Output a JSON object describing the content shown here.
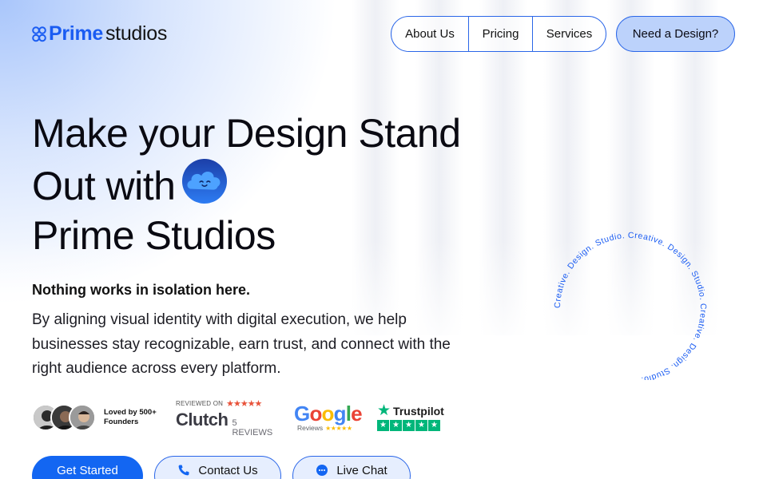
{
  "brand": {
    "name_bold": "Prime",
    "name_light": "studios",
    "accent": "#1a5cf2"
  },
  "nav": {
    "items": [
      "About Us",
      "Pricing",
      "Services"
    ],
    "cta": "Need a Design?"
  },
  "hero": {
    "title_line1": "Make your Design Stand",
    "title_line2": "Out with",
    "title_line3": "Prime Studios",
    "emoji_icon": "smiling-cloud-icon",
    "tagline": "Nothing works in isolation here.",
    "description": "By aligning visual identity with digital execution, we help businesses stay recognizable, earn trust, and connect with the right audience across every platform."
  },
  "social_proof": {
    "loved_by": "Loved by 500+ Founders",
    "clutch": {
      "reviewed_on": "REVIEWED ON",
      "name": "Clutch",
      "reviews": "5 REVIEWS",
      "stars": "★★★★★"
    },
    "google": {
      "letters": [
        "G",
        "o",
        "o",
        "g",
        "l",
        "e"
      ],
      "sub": "Reviews",
      "stars": "★★★★★"
    },
    "trustpilot": {
      "name": "Trustpilot",
      "star_glyph": "★",
      "stars": [
        "★",
        "★",
        "★",
        "★",
        "★"
      ]
    }
  },
  "buttons": {
    "get_started": "Get Started",
    "contact": "Contact Us",
    "chat": "Live Chat"
  },
  "ring_text": "Creative. Design. Studio. Creative. Design. Studio. Creative. Design. Studio. ",
  "colors": {
    "primary": "#1366f2",
    "outline": "#2a66e8",
    "trustpilot": "#00b67a",
    "clutch_star": "#e8523a"
  }
}
